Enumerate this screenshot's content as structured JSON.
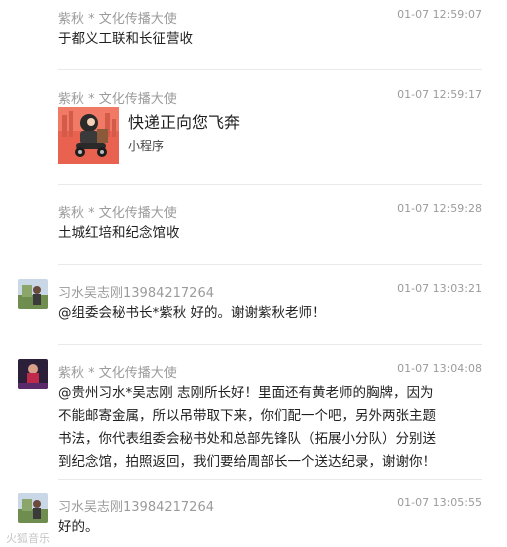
{
  "messages": [
    {
      "sender": "紫秋 * 文化传播大使",
      "time": "01-07 12:59:07",
      "text": "于都义工联和长征营收"
    },
    {
      "sender": "紫秋 * 文化传播大使",
      "time": "01-07 12:59:17",
      "mini_program": {
        "title": "快递正向您飞奔",
        "tag": "小程序"
      }
    },
    {
      "sender": "紫秋 * 文化传播大使",
      "time": "01-07 12:59:28",
      "text": "土城红培和纪念馆收"
    },
    {
      "sender": "习水吴志刚13984217264",
      "time": "01-07 13:03:21",
      "text": "@组委会秘书长*紫秋 好的。谢谢紫秋老师！"
    },
    {
      "sender": "紫秋 * 文化传播大使",
      "time": "01-07 13:04:08",
      "lines": [
        "@贵州习水*吴志刚 志刚所长好！里面还有黄老师的胸牌，因为",
        "不能邮寄金属，所以吊带取下来，你们配一个吧，另外两张主题",
        "书法，你代表组委会秘书处和总部先锋队（拓展小分队）分别送",
        "到纪念馆，拍照返回，我们要给周部长一个送达纪录，谢谢你！"
      ]
    },
    {
      "sender": "习水吴志刚13984217264",
      "time": "01-07 13:05:55",
      "text": "好的。"
    }
  ],
  "watermark": "火狐音乐",
  "colors": {
    "name": "#9b9b9b",
    "text": "#1f1f1f",
    "divider": "#e9e9e9",
    "background": "#ffffff"
  }
}
